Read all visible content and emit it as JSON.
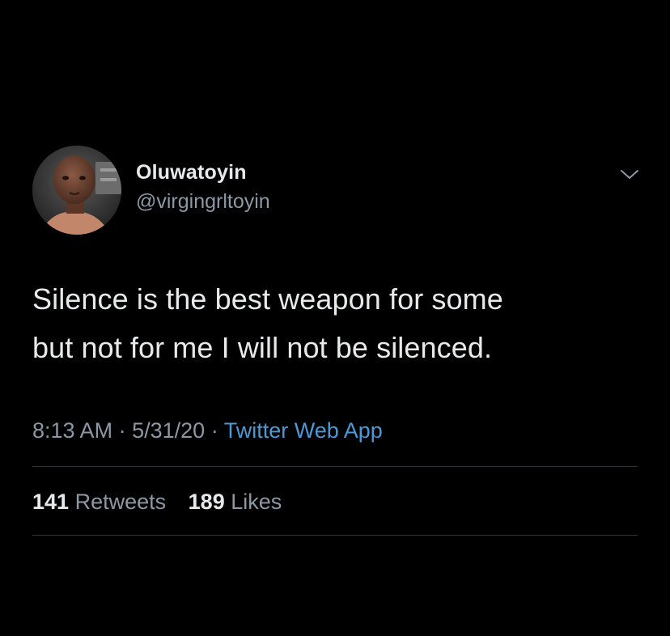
{
  "tweet": {
    "author": {
      "display_name": "Oluwatoyin",
      "handle": "@virgingrltoyin",
      "avatar": "profile-photo"
    },
    "text": "Silence is the best weapon for some\nbut not for me I will not be silenced.",
    "time": "8:13 AM",
    "separator": "·",
    "date": "5/31/20",
    "source": "Twitter Web App",
    "stats": {
      "retweets_count": "141",
      "retweets_label": "Retweets",
      "likes_count": "189",
      "likes_label": "Likes"
    },
    "menu_icon": "chevron-down-icon"
  },
  "colors": {
    "background": "#000000",
    "primary_text": "#e7e9ea",
    "secondary_text": "#8b98a5",
    "link": "#4a9ad7",
    "divider": "#2f3336"
  }
}
